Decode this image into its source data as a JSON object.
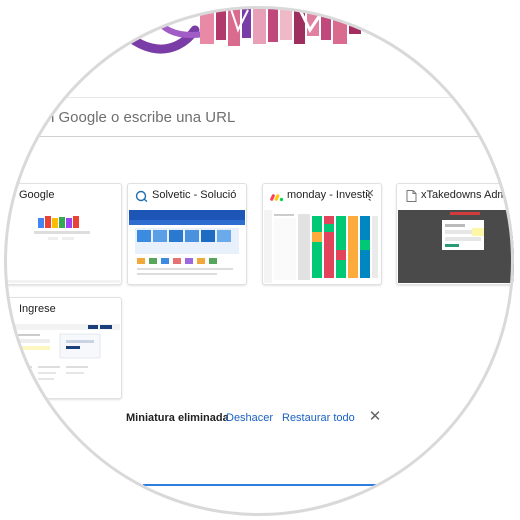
{
  "search": {
    "placeholder": "n Google o escribe una URL"
  },
  "tiles": [
    {
      "title": "Google",
      "favicon": "none"
    },
    {
      "title": "Solvetic - Solución ...",
      "favicon": "solvetic-icon"
    },
    {
      "title": "monday - Investigati...",
      "favicon": "monday-icon"
    },
    {
      "title": "xTakedowns Admin",
      "favicon": "page-icon"
    },
    {
      "title": "Ingrese",
      "favicon": "none"
    }
  ],
  "notification": {
    "message": "Miniatura eliminada",
    "undo": "Deshacer",
    "restore_all": "Restaurar todo"
  },
  "colors": {
    "link": "#1a62c2",
    "accent_line": "#2f7de1"
  }
}
